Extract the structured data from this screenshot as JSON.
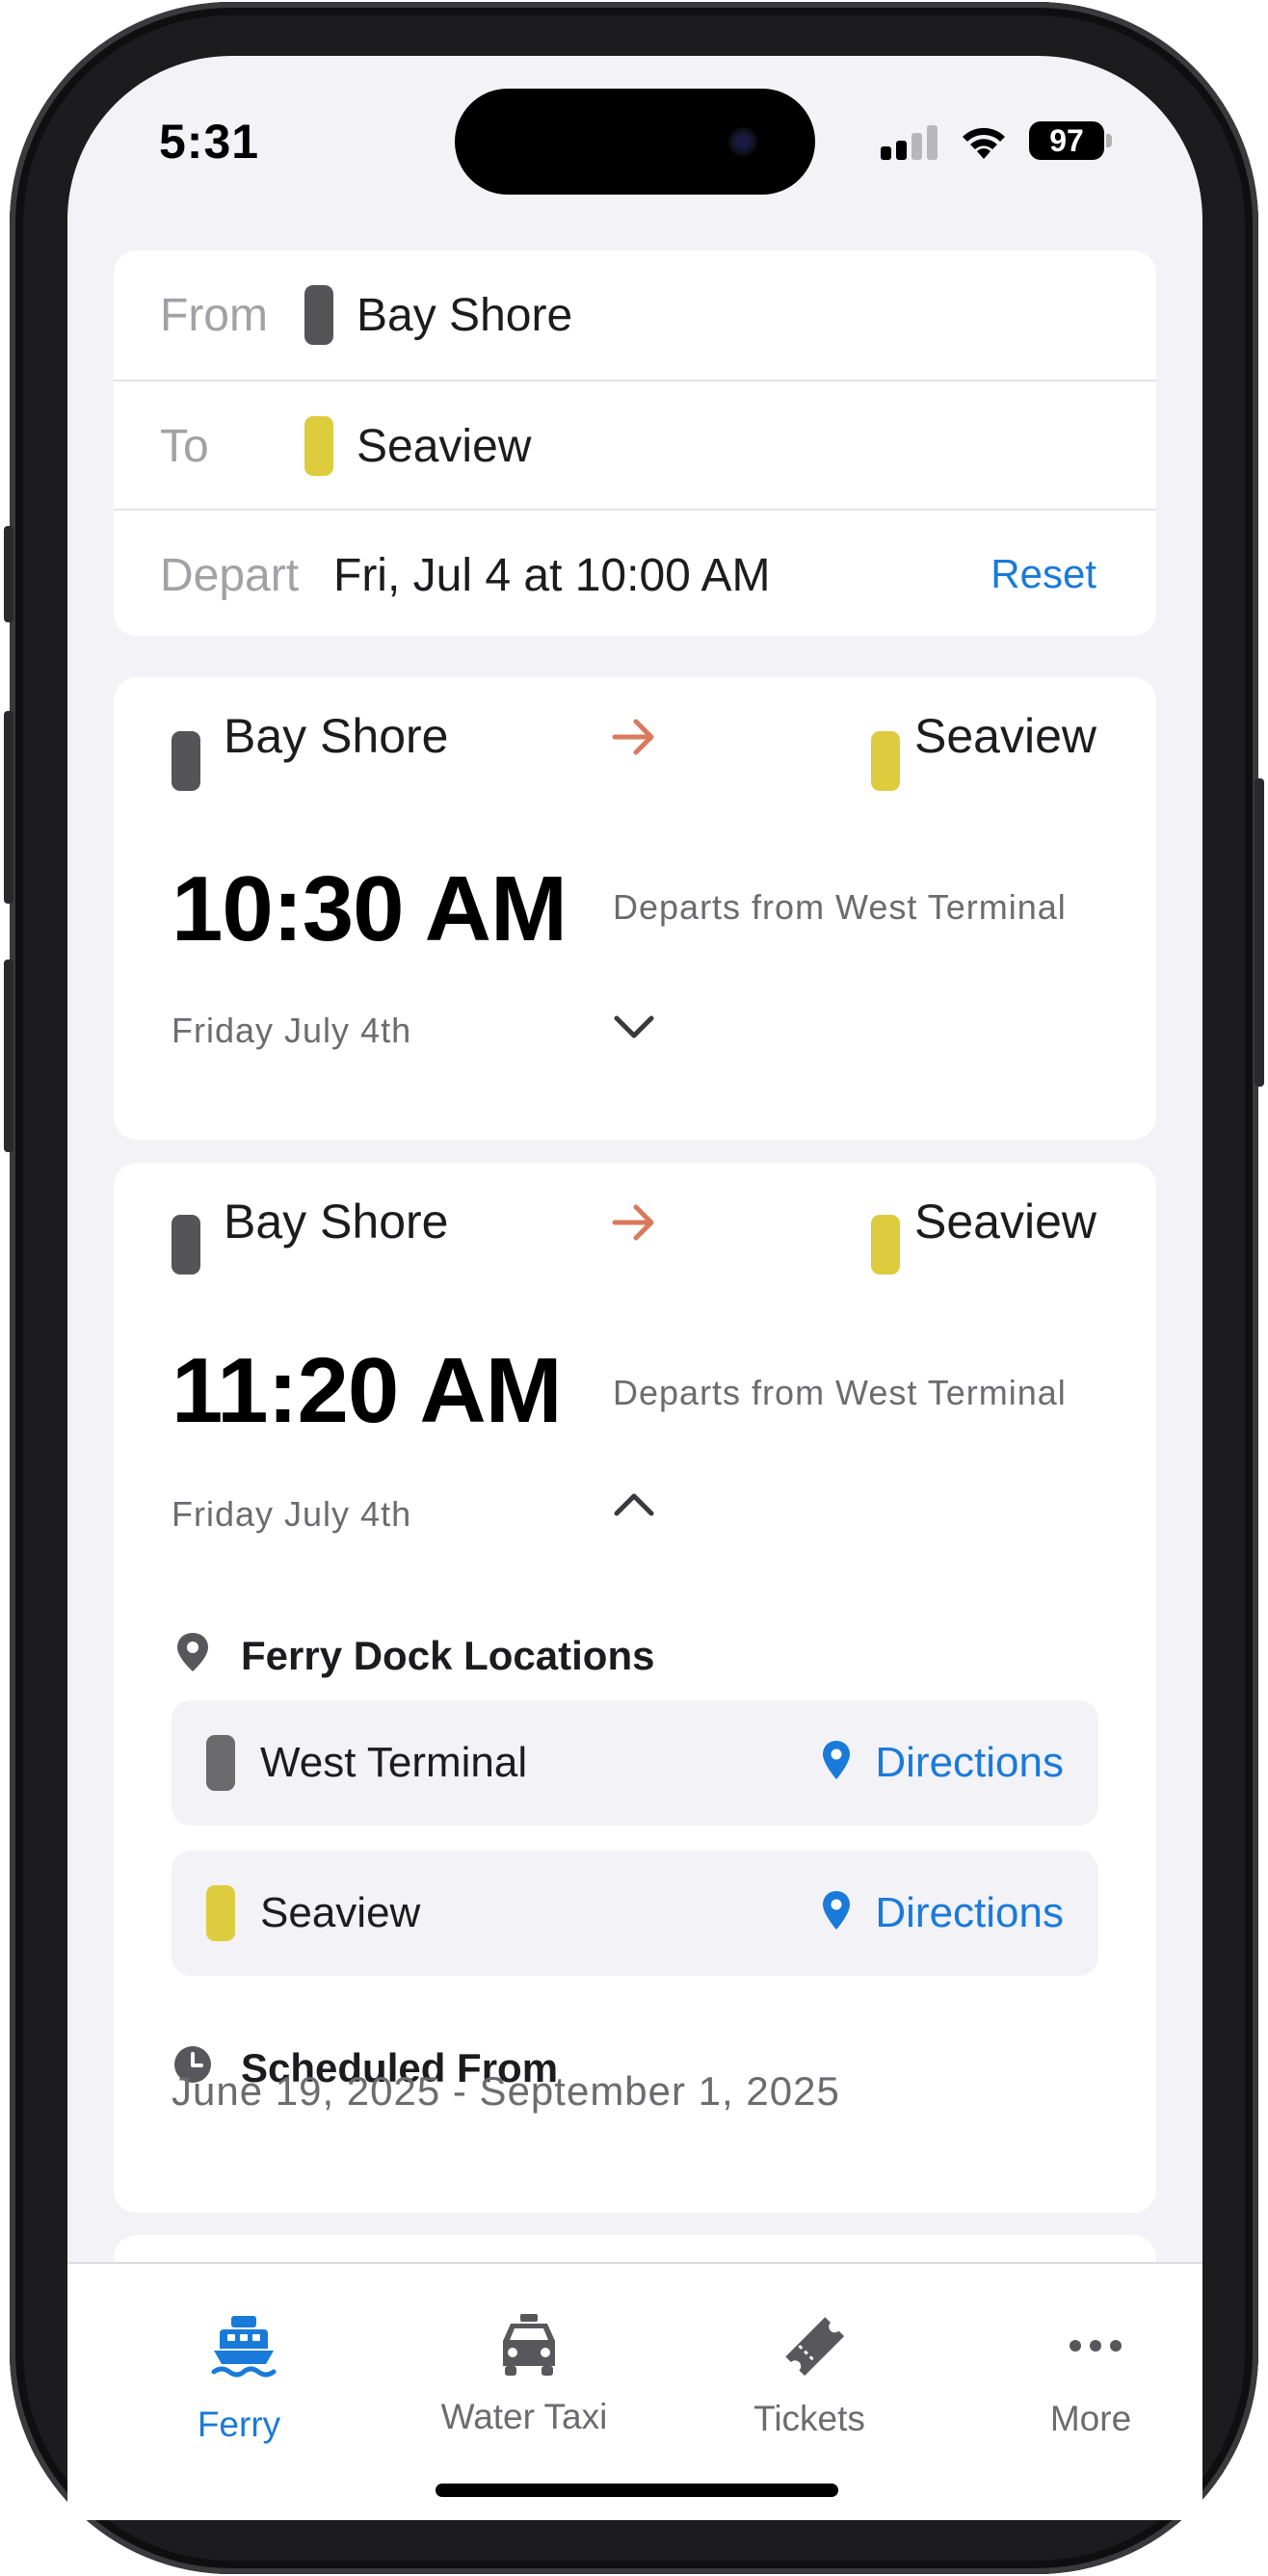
{
  "status_bar": {
    "time": "5:31",
    "battery": "97"
  },
  "search": {
    "from_label": "From",
    "from_value": "Bay Shore",
    "to_label": "To",
    "to_value": "Seaview",
    "depart_label": "Depart",
    "depart_value": "Fri, Jul 4 at 10:00 AM",
    "reset_label": "Reset"
  },
  "trips": [
    {
      "origin": "Bay Shore",
      "destination": "Seaview",
      "time": "10:30 AM",
      "terminal": "Departs from West Terminal",
      "date": "Friday July 4th",
      "expanded": false
    },
    {
      "origin": "Bay Shore",
      "destination": "Seaview",
      "time": "11:20 AM",
      "terminal": "Departs from West Terminal",
      "date": "Friday July 4th",
      "expanded": true,
      "details": {
        "dock_heading": "Ferry Dock Locations",
        "docks": [
          {
            "name": "West Terminal",
            "directions_label": "Directions",
            "color": "#6b6b6e"
          },
          {
            "name": "Seaview",
            "directions_label": "Directions",
            "color": "#ddcc3e"
          }
        ],
        "schedule_heading": "Scheduled From",
        "schedule_range": "June 19, 2025 - September 1, 2025"
      }
    }
  ],
  "tabbar": {
    "items": [
      {
        "label": "Ferry",
        "icon": "ferry-icon",
        "active": true
      },
      {
        "label": "Water Taxi",
        "icon": "taxi-icon",
        "active": false
      },
      {
        "label": "Tickets",
        "icon": "ticket-icon",
        "active": false
      },
      {
        "label": "More",
        "icon": "more-icon",
        "active": false
      }
    ]
  },
  "colors": {
    "accent": "#1a7ad9",
    "origin_line": "#555557",
    "destination_line": "#ddcc3e",
    "arrow": "#d9795e",
    "background": "#f2f2f7"
  }
}
